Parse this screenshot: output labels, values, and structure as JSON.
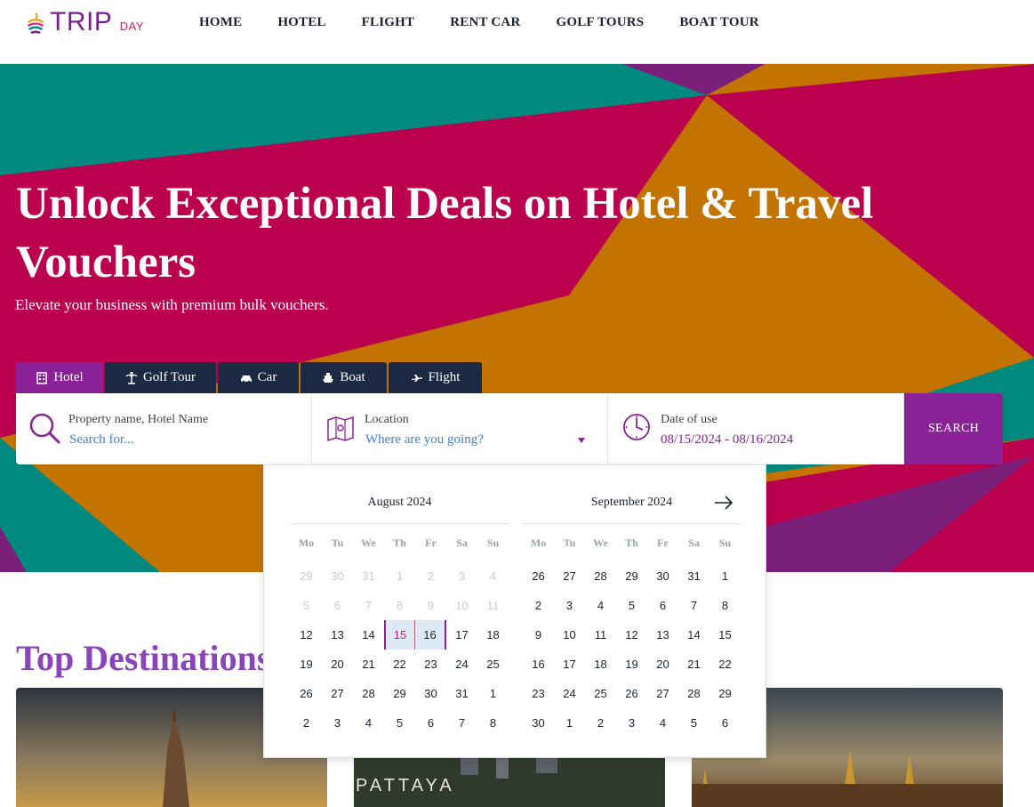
{
  "brand": {
    "trip": "TRIP",
    "day": "DAY"
  },
  "nav": [
    "HOME",
    "HOTEL",
    "FLIGHT",
    "RENT CAR",
    "GOLF TOURS",
    "BOAT TOUR"
  ],
  "hero": {
    "title": "Unlock Exceptional Deals on Hotel & Travel Vouchers",
    "subtitle": "Elevate your business with premium bulk vouchers."
  },
  "tabs": [
    "Hotel",
    "Golf Tour",
    "Car",
    "Boat",
    "Flight"
  ],
  "search": {
    "property_label": "Property name, Hotel Name",
    "property_placeholder": "Search for...",
    "location_label": "Location",
    "location_placeholder": "Where are you going?",
    "date_label": "Date of use",
    "date_value": "08/15/2024 - 08/16/2024",
    "button": "SEARCH"
  },
  "calendar": {
    "weekdays": [
      "Mo",
      "Tu",
      "We",
      "Th",
      "Fr",
      "Sa",
      "Su"
    ],
    "months": [
      {
        "title": "August 2024",
        "days": [
          "29",
          "30",
          "31",
          "1",
          "2",
          "3",
          "4",
          "5",
          "6",
          "7",
          "8",
          "9",
          "10",
          "11",
          "12",
          "13",
          "14",
          "15",
          "16",
          "17",
          "18",
          "19",
          "20",
          "21",
          "22",
          "23",
          "24",
          "25",
          "26",
          "27",
          "28",
          "29",
          "30",
          "31",
          "1",
          "2",
          "3",
          "4",
          "5",
          "6",
          "7",
          "8"
        ],
        "muted_until": 14,
        "selected": [
          17,
          18
        ]
      },
      {
        "title": "September 2024",
        "days": [
          "26",
          "27",
          "28",
          "29",
          "30",
          "31",
          "1",
          "2",
          "3",
          "4",
          "5",
          "6",
          "7",
          "8",
          "9",
          "10",
          "11",
          "12",
          "13",
          "14",
          "15",
          "16",
          "17",
          "18",
          "19",
          "20",
          "21",
          "22",
          "23",
          "24",
          "25",
          "26",
          "27",
          "28",
          "29",
          "30",
          "1",
          "2",
          "3",
          "4",
          "5",
          "6"
        ],
        "muted_until": 0,
        "selected": []
      }
    ]
  },
  "destinations": {
    "title": "Top Destinations"
  },
  "colors": {
    "brand_purple": "#8a2196",
    "brand_pink": "#d81b70",
    "navy": "#1b2a42",
    "teal": "#00897e",
    "orange": "#c37400",
    "crimson": "#bb004e"
  }
}
